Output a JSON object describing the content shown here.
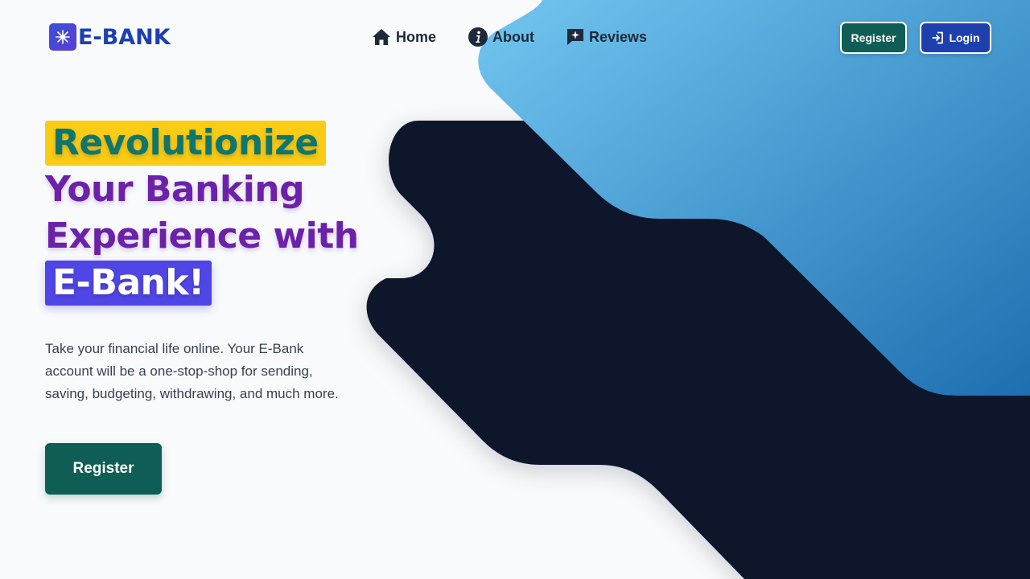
{
  "brand": {
    "name": "E-BANK",
    "logo_icon": "starburst-icon",
    "color": "#1e40af"
  },
  "nav": {
    "items": [
      {
        "label": "Home",
        "icon": "home-icon"
      },
      {
        "label": "About",
        "icon": "info-icon"
      },
      {
        "label": "Reviews",
        "icon": "sparkle-chat-icon"
      }
    ]
  },
  "header_buttons": {
    "register_label": "Register",
    "login_label": "Login",
    "login_icon": "login-arrow-icon"
  },
  "hero": {
    "headline_1": "Revolutionize",
    "headline_2": "Your Banking",
    "headline_3": "Experience with",
    "headline_4": "E-Bank!",
    "description": "Take your financial life online. Your E-Bank account will be a one-stop-shop for sending, saving, budgeting, withdrawing, and much more.",
    "cta_label": "Register"
  },
  "colors": {
    "accent_teal": "#0f5e56",
    "accent_blue": "#1e40af",
    "headline_purple": "#6b21a8",
    "highlight_yellow": "#facc15",
    "highlight_indigo": "#4f46e5",
    "dark_shape": "#0f172a",
    "light_blue_shape": "#60b8ea"
  }
}
